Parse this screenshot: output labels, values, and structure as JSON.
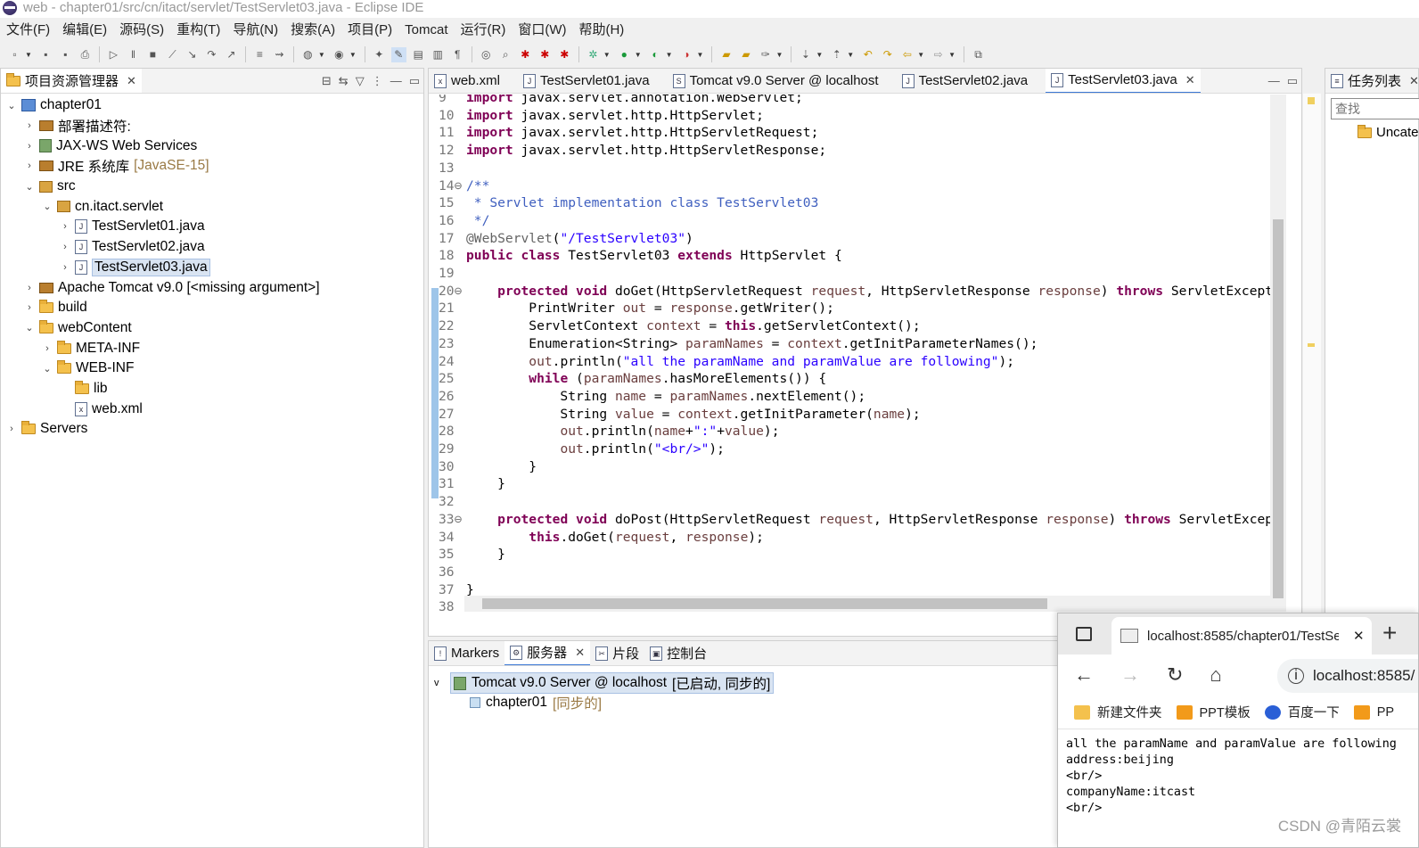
{
  "window": {
    "title": "web - chapter01/src/cn/itact/servlet/TestServlet03.java - Eclipse IDE"
  },
  "menu": [
    "文件(F)",
    "编辑(E)",
    "源码(S)",
    "重构(T)",
    "导航(N)",
    "搜索(A)",
    "项目(P)",
    "Tomcat",
    "运行(R)",
    "窗口(W)",
    "帮助(H)"
  ],
  "explorer": {
    "title": "项目资源管理器",
    "items": [
      {
        "label": "chapter01",
        "depth": 0,
        "arrow": "v",
        "icon": "proj"
      },
      {
        "label": "部署描述符:",
        "depth": 1,
        "arrow": ">",
        "icon": "jar"
      },
      {
        "label": "JAX-WS Web Services",
        "depth": 1,
        "arrow": ">",
        "icon": "srv"
      },
      {
        "label": "JRE 系统库",
        "suffix": "[JavaSE-15]",
        "depth": 1,
        "arrow": ">",
        "icon": "jar"
      },
      {
        "label": "src",
        "depth": 1,
        "arrow": "v",
        "icon": "pkg"
      },
      {
        "label": "cn.itact.servlet",
        "depth": 2,
        "arrow": "v",
        "icon": "pkg"
      },
      {
        "label": "TestServlet01.java",
        "depth": 3,
        "arrow": ">",
        "icon": "file"
      },
      {
        "label": "TestServlet02.java",
        "depth": 3,
        "arrow": ">",
        "icon": "file"
      },
      {
        "label": "TestServlet03.java",
        "depth": 3,
        "arrow": ">",
        "icon": "file",
        "selected": true
      },
      {
        "label": "Apache Tomcat v9.0 [<missing argument>]",
        "depth": 1,
        "arrow": ">",
        "icon": "jar"
      },
      {
        "label": "build",
        "depth": 1,
        "arrow": ">",
        "icon": "folder"
      },
      {
        "label": "webContent",
        "depth": 1,
        "arrow": "v",
        "icon": "folder"
      },
      {
        "label": "META-INF",
        "depth": 2,
        "arrow": ">",
        "icon": "folder"
      },
      {
        "label": "WEB-INF",
        "depth": 2,
        "arrow": "v",
        "icon": "folder"
      },
      {
        "label": "lib",
        "depth": 3,
        "arrow": "",
        "icon": "folder"
      },
      {
        "label": "web.xml",
        "depth": 3,
        "arrow": "",
        "icon": "xfile"
      },
      {
        "label": "Servers",
        "depth": 0,
        "arrow": ">",
        "icon": "folder"
      }
    ]
  },
  "editor": {
    "tabs": [
      {
        "label": "web.xml",
        "icon": "x"
      },
      {
        "label": "TestServlet01.java",
        "icon": "J"
      },
      {
        "label": "Tomcat v9.0 Server @ localhost",
        "icon": "S"
      },
      {
        "label": "TestServlet02.java",
        "icon": "J"
      },
      {
        "label": "TestServlet03.java",
        "icon": "J",
        "active": true
      }
    ],
    "lines": [
      {
        "n": "9",
        "t": "import javax.servlet.annotation.WebServlet;"
      },
      {
        "n": "10",
        "t": "import javax.servlet.http.HttpServlet;"
      },
      {
        "n": "11",
        "t": "import javax.servlet.http.HttpServletRequest;"
      },
      {
        "n": "12",
        "t": "import javax.servlet.http.HttpServletResponse;"
      },
      {
        "n": "13",
        "t": ""
      },
      {
        "n": "14⊖",
        "t": "/**"
      },
      {
        "n": "15",
        "t": " * Servlet implementation class TestServlet03"
      },
      {
        "n": "16",
        "t": " */"
      },
      {
        "n": "17",
        "t": "@WebServlet(\"/TestServlet03\")"
      },
      {
        "n": "18",
        "t": "public class TestServlet03 extends HttpServlet {"
      },
      {
        "n": "19",
        "t": ""
      },
      {
        "n": "20⊖",
        "t": "    protected void doGet(HttpServletRequest request, HttpServletResponse response) throws ServletExcept"
      },
      {
        "n": "21",
        "t": "        PrintWriter out = response.getWriter();"
      },
      {
        "n": "22",
        "t": "        ServletContext context = this.getServletContext();"
      },
      {
        "n": "23",
        "t": "        Enumeration<String> paramNames = context.getInitParameterNames();"
      },
      {
        "n": "24",
        "t": "        out.println(\"all the paramName and paramValue are following\");"
      },
      {
        "n": "25",
        "t": "        while (paramNames.hasMoreElements()) {"
      },
      {
        "n": "26",
        "t": "            String name = paramNames.nextElement();"
      },
      {
        "n": "27",
        "t": "            String value = context.getInitParameter(name);"
      },
      {
        "n": "28",
        "t": "            out.println(name+\":\"+value);"
      },
      {
        "n": "29",
        "t": "            out.println(\"<br/>\");"
      },
      {
        "n": "30",
        "t": "        }"
      },
      {
        "n": "31",
        "t": "    }"
      },
      {
        "n": "32",
        "t": ""
      },
      {
        "n": "33⊖",
        "t": "    protected void doPost(HttpServletRequest request, HttpServletResponse response) throws ServletExcep"
      },
      {
        "n": "34",
        "t": "        this.doGet(request, response);"
      },
      {
        "n": "35",
        "t": "    }"
      },
      {
        "n": "36",
        "t": ""
      },
      {
        "n": "37",
        "t": "}"
      },
      {
        "n": "38",
        "t": ""
      }
    ]
  },
  "bottom": {
    "tabs": [
      {
        "label": "Markers"
      },
      {
        "label": "服务器",
        "active": true
      },
      {
        "label": "片段"
      },
      {
        "label": "控制台"
      }
    ],
    "server": {
      "label": "Tomcat v9.0 Server @ localhost",
      "status": "[已启动, 同步的]"
    },
    "module": {
      "label": "chapter01",
      "status": "[同步的]"
    }
  },
  "tasks": {
    "title": "任务列表",
    "search_placeholder": "查找",
    "item": "Uncate"
  },
  "browser": {
    "tab_title": "localhost:8585/chapter01/TestSe",
    "address": "localhost:8585/",
    "bookmarks": [
      "新建文件夹",
      "PPT模板",
      "百度一下",
      "PP"
    ],
    "content": "all the paramName and paramValue are following\naddress:beijing\n<br/>\ncompanyName:itcast\n<br/>"
  },
  "watermark": "CSDN @青陌云裳",
  "colors": {
    "keyword": "#7f0055",
    "string": "#2a00ff",
    "comment": "#3f5fbf",
    "field": "#0000c0",
    "selection": "#d9e4f2"
  }
}
